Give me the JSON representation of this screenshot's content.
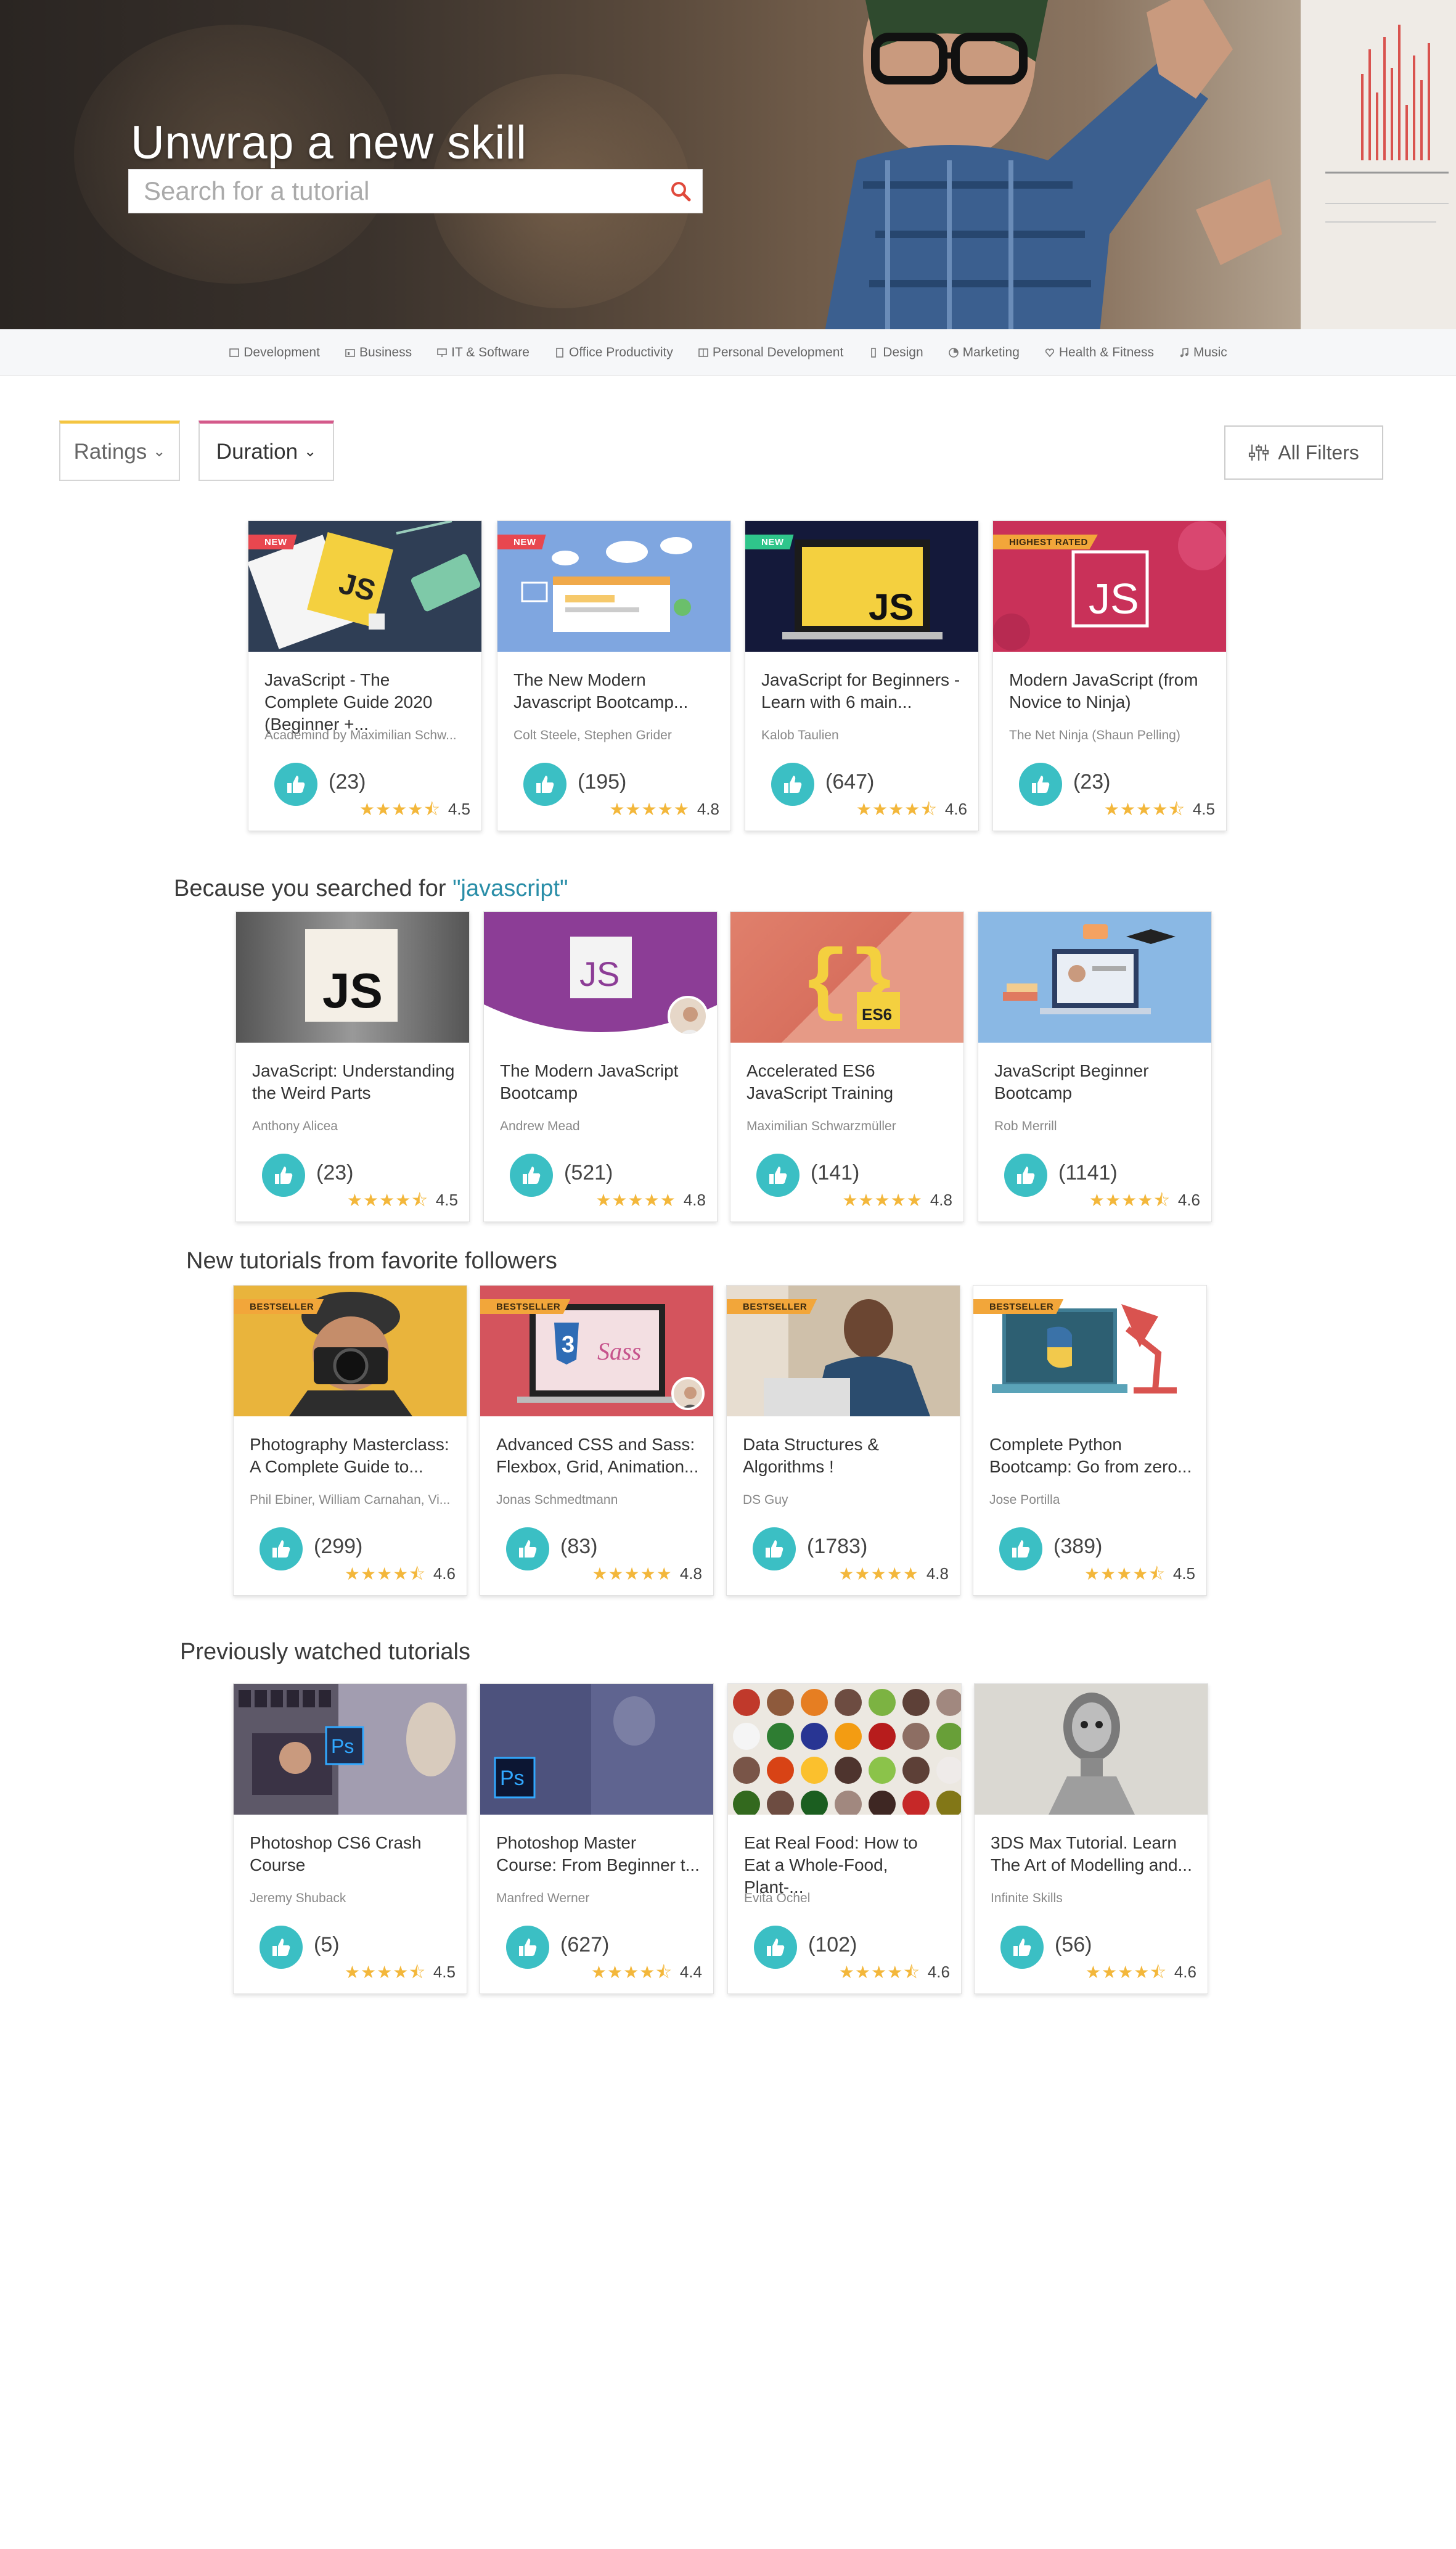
{
  "hero": {
    "title": "Unwrap a new skill",
    "search_placeholder": "Search for a tutorial"
  },
  "categories": [
    {
      "label": "Development",
      "icon": "code-icon"
    },
    {
      "label": "Business",
      "icon": "briefcase-icon"
    },
    {
      "label": "IT & Software",
      "icon": "monitor-icon"
    },
    {
      "label": "Office Productivity",
      "icon": "document-icon"
    },
    {
      "label": "Personal Development",
      "icon": "book-icon"
    },
    {
      "label": "Design",
      "icon": "pen-icon"
    },
    {
      "label": "Marketing",
      "icon": "chart-icon"
    },
    {
      "label": "Health & Fitness",
      "icon": "heart-icon"
    },
    {
      "label": "Music",
      "icon": "music-icon"
    }
  ],
  "filters": {
    "ratings_label": "Ratings",
    "duration_label": "Duration",
    "all_filters_label": "All Filters"
  },
  "sections": {
    "searched_prefix": "Because you searched for ",
    "searched_query": "\"javascript\"",
    "followers_title": "New tutorials from favorite followers",
    "watched_title": "Previously watched tutorials"
  },
  "row1": [
    {
      "badge": "NEW",
      "title": "JavaScript - The Complete Guide 2020 (Beginner +...",
      "author": "Academind by Maximilian Schw...",
      "count": "(23)",
      "rating": "4.5"
    },
    {
      "badge": "NEW",
      "title": "The New Modern Javascript Bootcamp...",
      "author": "Colt Steele, Stephen Grider",
      "count": "(195)",
      "rating": "4.8"
    },
    {
      "badge": "NEW",
      "title": "JavaScript for Beginners - Learn with 6 main...",
      "author": "Kalob Taulien",
      "count": "(647)",
      "rating": "4.6"
    },
    {
      "badge": "HIGHEST RATED",
      "title": "Modern JavaScript (from Novice to Ninja)",
      "author": "The Net Ninja (Shaun Pelling)",
      "count": "(23)",
      "rating": "4.5"
    }
  ],
  "row2": [
    {
      "title": "JavaScript: Understanding the Weird Parts",
      "author": "Anthony Alicea",
      "count": "(23)",
      "rating": "4.5"
    },
    {
      "title": "The Modern JavaScript Bootcamp",
      "author": "Andrew Mead",
      "count": "(521)",
      "rating": "4.8"
    },
    {
      "title": "Accelerated ES6 JavaScript Training",
      "author": "Maximilian Schwarzmüller",
      "count": "(141)",
      "rating": "4.8"
    },
    {
      "title": "JavaScript Beginner Bootcamp",
      "author": "Rob Merrill",
      "count": "(1141)",
      "rating": "4.6"
    }
  ],
  "row3": [
    {
      "badge": "BESTSELLER",
      "title": "Photography Masterclass: A Complete Guide to...",
      "author": "Phil Ebiner, William Carnahan, Vi...",
      "count": "(299)",
      "rating": "4.6"
    },
    {
      "badge": "BESTSELLER",
      "title": "Advanced CSS and Sass: Flexbox, Grid, Animation...",
      "author": "Jonas Schmedtmann",
      "count": "(83)",
      "rating": "4.8"
    },
    {
      "badge": "BESTSELLER",
      "title": "Data Structures & Algorithms !",
      "author": "DS Guy",
      "count": "(1783)",
      "rating": "4.8"
    },
    {
      "badge": "BESTSELLER",
      "title": "Complete Python Bootcamp: Go from zero...",
      "author": "Jose Portilla",
      "count": "(389)",
      "rating": "4.5"
    }
  ],
  "row4": [
    {
      "title": "Photoshop CS6 Crash Course",
      "author": "Jeremy Shuback",
      "count": "(5)",
      "rating": "4.5"
    },
    {
      "title": "Photoshop Master Course: From Beginner t...",
      "author": "Manfred Werner",
      "count": "(627)",
      "rating": "4.4"
    },
    {
      "title": "Eat Real Food: How to Eat a Whole-Food, Plant-...",
      "author": "Evita Ochel",
      "count": "(102)",
      "rating": "4.6"
    },
    {
      "title": "3DS Max Tutorial. Learn The Art of Modelling and...",
      "author": "Infinite Skills",
      "count": "(56)",
      "rating": "4.6"
    }
  ],
  "thumb_texts": {
    "js": "JS",
    "es6": "ES6",
    "css3": "3",
    "sass": "Sass",
    "ps": "Ps"
  },
  "colors": {
    "accent_teal": "#3bbfc4",
    "star": "#f3b73b",
    "ratings_tab": "#f4c542",
    "duration_tab": "#d45a8b",
    "query": "#2a8ea8"
  }
}
